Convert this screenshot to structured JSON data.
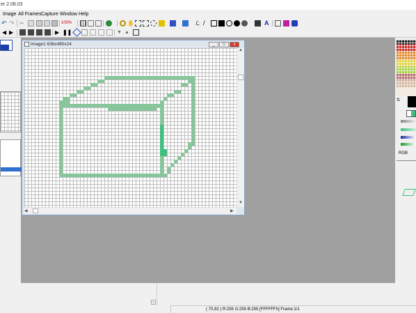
{
  "title": "er 2.08.03",
  "menu": [
    "Image",
    "All Frames",
    "Capture",
    "Window",
    "Help"
  ],
  "toolbar": {
    "zoom": "100%"
  },
  "child_window": {
    "title": "Image1 63bx480x24",
    "min": "_",
    "max": "□",
    "close": "x"
  },
  "right_panel": {
    "rgb_label": "RGB"
  },
  "status": {
    "text": "( 70,92 )  R:255 G:255 B:255   [FFFFFFh]   Frame:1/1"
  },
  "colors": {
    "accent": "#86c69a",
    "accent_dark": "#3fbf7f",
    "workspace": "#a0a0a0",
    "panel": "#f0f0f0"
  }
}
